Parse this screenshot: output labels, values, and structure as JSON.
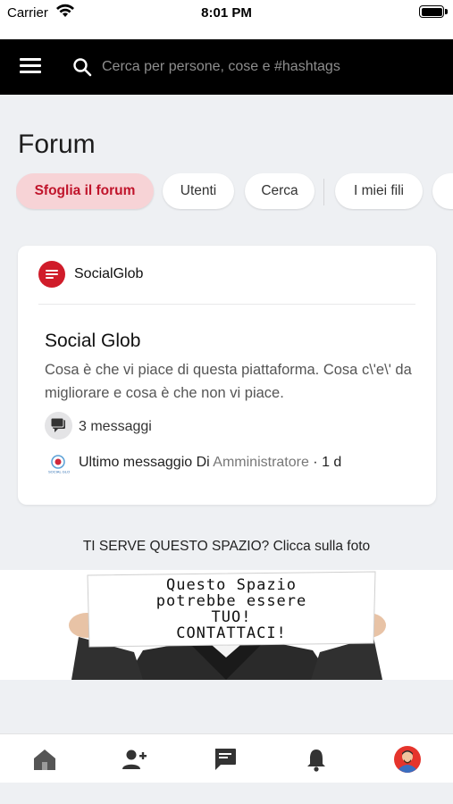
{
  "status_bar": {
    "carrier": "Carrier",
    "time": "8:01 PM"
  },
  "header": {
    "search_placeholder": "Cerca per persone, cose e #hashtags"
  },
  "page": {
    "title": "Forum"
  },
  "tabs": [
    {
      "label": "Sfoglia il forum",
      "active": true
    },
    {
      "label": "Utenti",
      "active": false
    },
    {
      "label": "Cerca",
      "active": false
    },
    {
      "label": "I miei fili",
      "active": false
    }
  ],
  "topic_card": {
    "category": "SocialGlob",
    "title": "Social Glob",
    "description": "Cosa è che vi piace di questa piattaforma. Cosa c\\'e\\' da migliorare e cosa è che non vi piace.",
    "message_count": "3 messaggi",
    "last_message_prefix": "Ultimo messaggio Di",
    "last_message_author": "Amministratore",
    "last_message_time": "1 d"
  },
  "promo": {
    "text": "TI SERVE QUESTO SPAZIO? Clicca sulla foto",
    "sign_line1": "Questo Spazio",
    "sign_line2": "potrebbe essere",
    "sign_line3": "TUO!",
    "sign_line4": "CONTATTACI!"
  },
  "colors": {
    "accent": "#c0142b",
    "accent_bg": "#f7d3d6",
    "header_bg": "#000000",
    "page_bg": "#eef0f3"
  },
  "icons": [
    "menu-icon",
    "search-icon",
    "forum-category-icon",
    "messages-icon",
    "home-icon",
    "add-user-icon",
    "chat-icon",
    "bell-icon",
    "profile-avatar"
  ]
}
